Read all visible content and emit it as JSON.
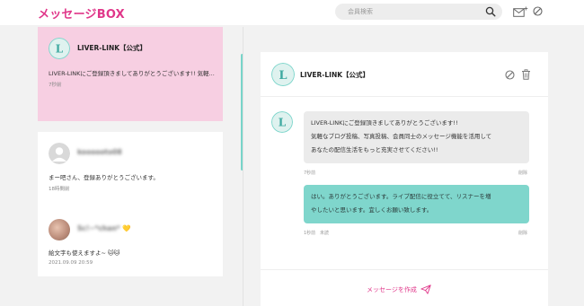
{
  "header": {
    "brand": "メッセージBOX",
    "search_placeholder": "会員検索"
  },
  "conversations": [
    {
      "name": "LIVER-LINK【公式】",
      "preview": "LIVER-LINKにご登録頂きましてありがとうございます!! 気軽...",
      "time": "7秒前",
      "active": true
    },
    {
      "name": "koooooto08",
      "preview": "まー吧さん、登録ありがとうございます。",
      "time": "18時間前"
    },
    {
      "name": "Sc!~*chan*",
      "preview": "絵文字も使えますよ~",
      "time": "2021.09.09 20:59"
    },
    {
      "name": "~~~ ~~ ~ ~~~"
    }
  ],
  "thread": {
    "name": "LIVER-LINK【公式】",
    "messages": [
      {
        "lines": [
          "LIVER-LINKにご登録頂きましてありがとうございます!!",
          "気軽なブログ投稿、写真投稿、会員同士のメッセージ機能を活用して",
          "あなたの配信生活をもっと充実させてください!!"
        ],
        "time": "7秒前",
        "action": "削除"
      },
      {
        "lines": [
          "はい。ありがとうございます。ライブ配信に役立てて、リスナーを増",
          "やしたいと思います。宜しくお願い致します。"
        ],
        "time": "1秒前",
        "status": "未読",
        "action": "削除"
      }
    ],
    "compose_label": "メッセージを作成"
  },
  "colors": {
    "brand": "#e0378a",
    "accent_teal": "#7fd6cc",
    "active_card": "#f7cfe2"
  }
}
